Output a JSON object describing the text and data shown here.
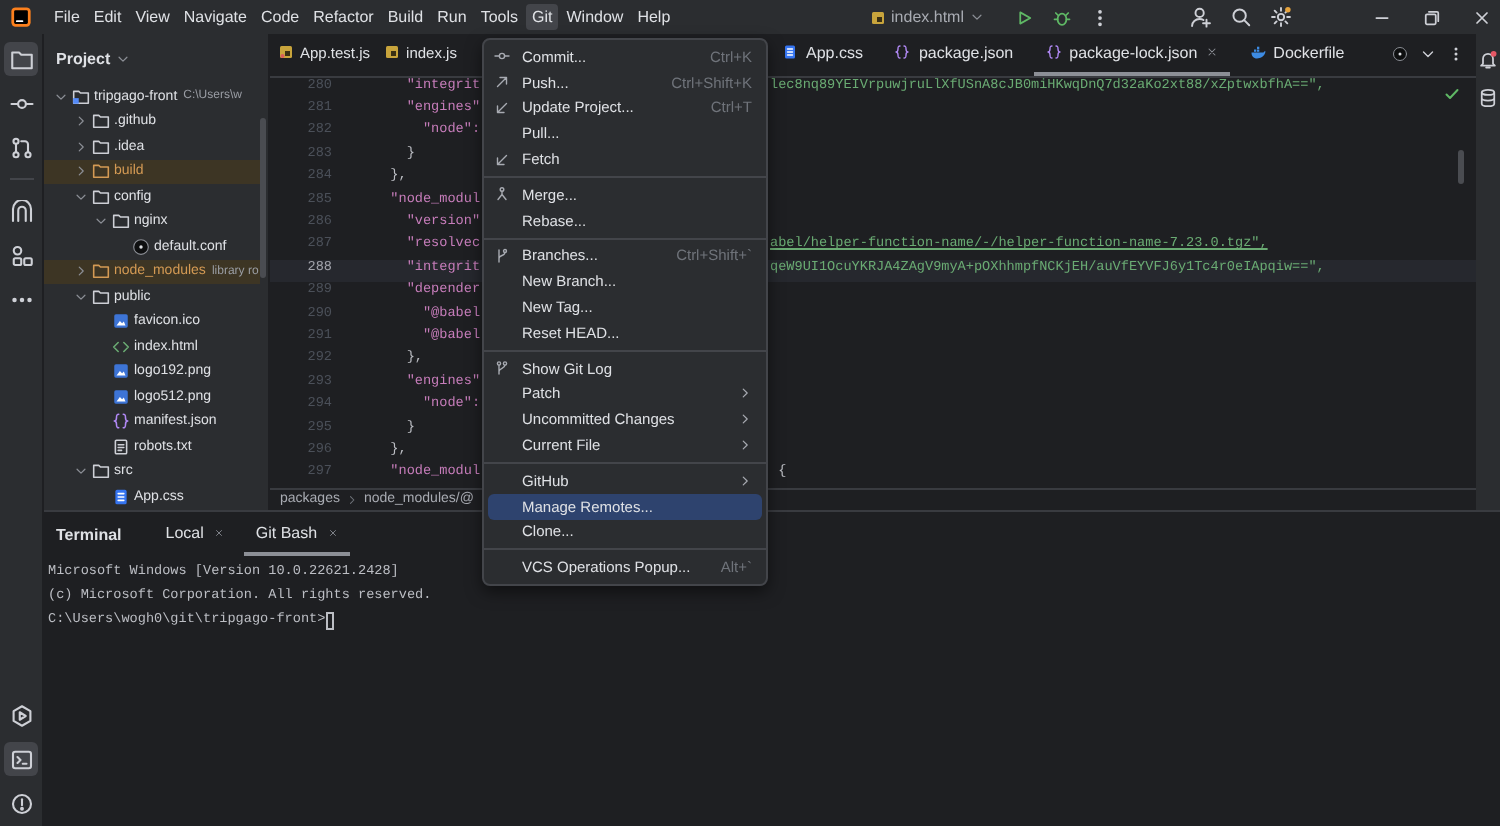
{
  "title_bar": {
    "menus": [
      {
        "label": "File",
        "selected": false
      },
      {
        "label": "Edit",
        "selected": false
      },
      {
        "label": "View",
        "selected": false
      },
      {
        "label": "Navigate",
        "selected": false
      },
      {
        "label": "Code",
        "selected": false
      },
      {
        "label": "Refactor",
        "selected": false
      },
      {
        "label": "Build",
        "selected": false
      },
      {
        "label": "Run",
        "selected": false
      },
      {
        "label": "Tools",
        "selected": false
      },
      {
        "label": "Git",
        "selected": true
      },
      {
        "label": "Window",
        "selected": false
      },
      {
        "label": "Help",
        "selected": false
      }
    ],
    "run_config": "index.html"
  },
  "tool_strip": {
    "top": [
      [
        {
          "kind": "folder",
          "selected": true
        },
        {
          "kind": "commit",
          "selected": false
        },
        {
          "kind": "pull-requests",
          "selected": false
        }
      ],
      [
        {
          "kind": "arch",
          "selected": false
        },
        {
          "kind": "shapes",
          "selected": false
        },
        {
          "kind": "more",
          "selected": false
        }
      ]
    ],
    "bottom": [
      {
        "kind": "run",
        "selected": false
      },
      {
        "kind": "terminal",
        "selected": true
      },
      {
        "kind": "problems",
        "selected": false
      }
    ]
  },
  "project": {
    "title": "Project",
    "tree": [
      {
        "label": "tripgago-front",
        "kind": "module",
        "note": "C:\\Users\\w",
        "expanded": true,
        "excluded": false,
        "children": [
          {
            "label": ".github",
            "kind": "folder",
            "expanded": false,
            "excluded": false
          },
          {
            "label": ".idea",
            "kind": "folder",
            "expanded": false,
            "excluded": false
          },
          {
            "label": "build",
            "kind": "folder",
            "expanded": false,
            "excluded": true
          },
          {
            "label": "config",
            "kind": "folder",
            "expanded": true,
            "excluded": false,
            "children": [
              {
                "label": "nginx",
                "kind": "folder",
                "expanded": true,
                "excluded": false,
                "children": [
                  {
                    "label": "default.conf",
                    "kind": "nginx-file",
                    "excluded": false
                  }
                ]
              }
            ]
          },
          {
            "label": "node_modules",
            "kind": "folder",
            "note": "library ro",
            "expanded": false,
            "excluded": true
          },
          {
            "label": "public",
            "kind": "folder",
            "expanded": true,
            "excluded": false,
            "children": [
              {
                "label": "favicon.ico",
                "kind": "image-file",
                "excluded": false
              },
              {
                "label": "index.html",
                "kind": "html-file",
                "excluded": false
              },
              {
                "label": "logo192.png",
                "kind": "image-file",
                "excluded": false
              },
              {
                "label": "logo512.png",
                "kind": "image-file",
                "excluded": false
              },
              {
                "label": "manifest.json",
                "kind": "json-file",
                "excluded": false
              },
              {
                "label": "robots.txt",
                "kind": "text-file",
                "excluded": false
              }
            ]
          },
          {
            "label": "src",
            "kind": "folder",
            "expanded": true,
            "excluded": false,
            "children": [
              {
                "label": "App.css",
                "kind": "css-file",
                "excluded": false
              }
            ]
          }
        ]
      }
    ]
  },
  "editor": {
    "tabs_left": [
      {
        "label": "App.test.js",
        "kind": "test-js",
        "selected": false
      },
      {
        "label": "index.js",
        "kind": "js",
        "selected": false
      }
    ],
    "tabs_right": [
      {
        "label": "App.css",
        "kind": "css",
        "selected": false
      },
      {
        "label": "package.json",
        "kind": "json",
        "selected": false
      },
      {
        "label": "package-lock.json",
        "kind": "json",
        "selected": true
      },
      {
        "label": "Dockerfile",
        "kind": "docker",
        "selected": false
      }
    ],
    "lines": [
      {
        "number": "280",
        "code": {
          "text": "    \"integrit",
          "kind": "key"
        },
        "tail": {
          "text": "lec8nq89YEIVrpuwjruLlXfUSnA8cJB0miHKwqDnQ7d32aKo2xt88/xZptwxbfhA==\",",
          "kind": "string"
        },
        "current": false
      },
      {
        "number": "281",
        "code": {
          "text": "    \"engines\"",
          "kind": "key"
        },
        "current": false
      },
      {
        "number": "282",
        "code": {
          "text": "      \"node\":",
          "kind": "key"
        },
        "current": false
      },
      {
        "number": "283",
        "code": {
          "text": "    }",
          "kind": "punct"
        },
        "current": false
      },
      {
        "number": "284",
        "code": {
          "text": "  },",
          "kind": "punct"
        },
        "current": false
      },
      {
        "number": "285",
        "code": {
          "text": "  \"node_modul",
          "kind": "key"
        },
        "current": false
      },
      {
        "number": "286",
        "code": {
          "text": "    \"version\"",
          "kind": "key"
        },
        "current": false
      },
      {
        "number": "287",
        "code": {
          "text": "    \"resolvec",
          "kind": "key"
        },
        "tail": {
          "text": "abel/helper-function-name/-/helper-function-name-7.23.0.tgz\",",
          "kind": "url"
        },
        "current": false
      },
      {
        "number": "288",
        "code": {
          "text": "    \"integrit",
          "kind": "key"
        },
        "tail": {
          "text": "qeW9UI1OcuYKRJA4ZAgV9myA+pOXhhmpfNCKjEH/auVfEYVFJ6y1Tc4r0eIApqiw==\",",
          "kind": "string"
        },
        "current": true
      },
      {
        "number": "289",
        "code": {
          "text": "    \"depender",
          "kind": "key"
        },
        "current": false
      },
      {
        "number": "290",
        "code": {
          "text": "      \"@babel",
          "kind": "key"
        },
        "current": false
      },
      {
        "number": "291",
        "code": {
          "text": "      \"@babel",
          "kind": "key"
        },
        "current": false
      },
      {
        "number": "292",
        "code": {
          "text": "    },",
          "kind": "punct"
        },
        "current": false
      },
      {
        "number": "293",
        "code": {
          "text": "    \"engines\"",
          "kind": "key"
        },
        "current": false
      },
      {
        "number": "294",
        "code": {
          "text": "      \"node\":",
          "kind": "key"
        },
        "current": false
      },
      {
        "number": "295",
        "code": {
          "text": "    }",
          "kind": "punct"
        },
        "current": false
      },
      {
        "number": "296",
        "code": {
          "text": "  },",
          "kind": "punct"
        },
        "current": false
      },
      {
        "number": "297",
        "code": {
          "text": "  \"node_modul",
          "kind": "key"
        },
        "tail": {
          "text": " {",
          "kind": "punct"
        },
        "current": false
      }
    ],
    "breadcrumb": [
      "packages",
      "node_modules/@"
    ]
  },
  "terminal": {
    "title": "Terminal",
    "tabs": [
      {
        "label": "Local",
        "selected": false
      },
      {
        "label": "Git Bash",
        "selected": true
      }
    ],
    "lines": [
      "Microsoft Windows [Version 10.0.22621.2428]",
      "(c) Microsoft Corporation. All rights reserved."
    ],
    "prompt": "C:\\Users\\wogh0\\git\\tripgago-front>"
  },
  "git_menu": {
    "groups": [
      {
        "items": [
          {
            "label": "Commit...",
            "kind": "commit",
            "shortcut": "Ctrl+K",
            "submenu": false,
            "selected": false
          },
          {
            "label": "Push...",
            "kind": "push",
            "shortcut": "Ctrl+Shift+K",
            "submenu": false,
            "selected": false
          },
          {
            "label": "Update Project...",
            "kind": "update",
            "shortcut": "Ctrl+T",
            "submenu": false,
            "selected": false
          },
          {
            "label": "Pull...",
            "kind": "plain",
            "submenu": false,
            "selected": false
          },
          {
            "label": "Fetch",
            "kind": "fetch",
            "submenu": false,
            "selected": false
          }
        ]
      },
      {
        "items": [
          {
            "label": "Merge...",
            "kind": "merge",
            "submenu": false,
            "selected": false
          },
          {
            "label": "Rebase...",
            "kind": "plain",
            "submenu": false,
            "selected": false
          }
        ]
      },
      {
        "items": [
          {
            "label": "Branches...",
            "kind": "branch",
            "shortcut": "Ctrl+Shift+`",
            "submenu": false,
            "selected": false
          },
          {
            "label": "New Branch...",
            "kind": "plain",
            "submenu": false,
            "selected": false
          },
          {
            "label": "New Tag...",
            "kind": "plain",
            "submenu": false,
            "selected": false
          },
          {
            "label": "Reset HEAD...",
            "kind": "plain",
            "submenu": false,
            "selected": false
          }
        ]
      },
      {
        "items": [
          {
            "label": "Show Git Log",
            "kind": "log",
            "submenu": false,
            "selected": false
          },
          {
            "label": "Patch",
            "kind": "plain",
            "submenu": true,
            "selected": false
          },
          {
            "label": "Uncommitted Changes",
            "kind": "plain",
            "submenu": true,
            "selected": false
          },
          {
            "label": "Current File",
            "kind": "plain",
            "submenu": true,
            "selected": false
          }
        ]
      },
      {
        "items": [
          {
            "label": "GitHub",
            "kind": "plain",
            "submenu": true,
            "selected": false
          },
          {
            "label": "Manage Remotes...",
            "kind": "plain",
            "submenu": false,
            "selected": true
          },
          {
            "label": "Clone...",
            "kind": "plain",
            "submenu": false,
            "selected": false
          }
        ]
      },
      {
        "items": [
          {
            "label": "VCS Operations Popup...",
            "kind": "plain",
            "shortcut": "Alt+`",
            "submenu": false,
            "selected": false
          }
        ]
      }
    ]
  }
}
